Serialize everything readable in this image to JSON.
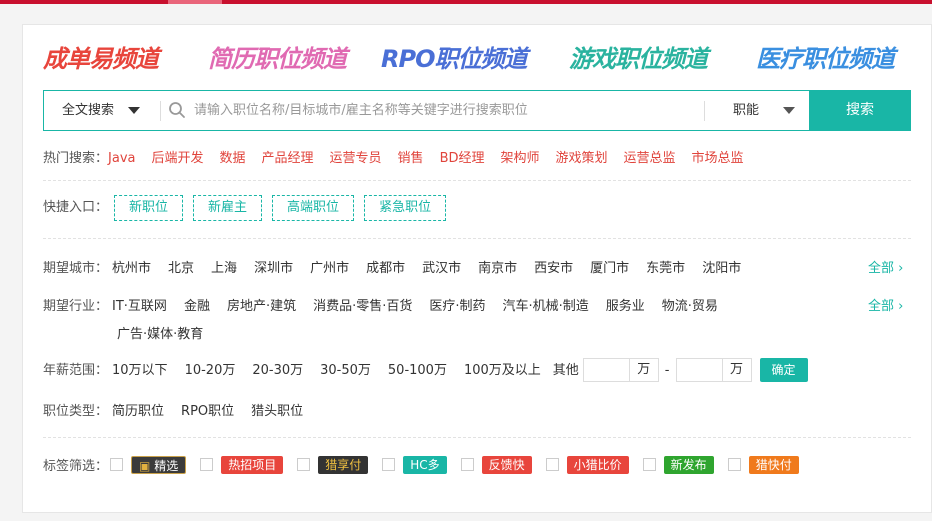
{
  "channels": [
    {
      "label": "成单易频道",
      "color": "#e8453c"
    },
    {
      "label": "简历职位频道",
      "color": "#e06ab2"
    },
    {
      "label": "RPO职位频道",
      "color": "#4a6fd6"
    },
    {
      "label": "游戏职位频道",
      "color": "#2ab39f"
    },
    {
      "label": "医疗职位频道",
      "color": "#3a8fe0"
    }
  ],
  "search": {
    "scope": "全文搜索",
    "placeholder": "请输入职位名称/目标城市/雇主名称等关键字进行搜索职位",
    "function": "职能",
    "button": "搜索",
    "accent": "#19b6a6"
  },
  "hot": {
    "label": "热门搜索：",
    "items": [
      "Java",
      "后端开发",
      "数据",
      "产品经理",
      "运营专员",
      "销售",
      "BD经理",
      "架构师",
      "游戏策划",
      "运营总监",
      "市场总监"
    ]
  },
  "quick": {
    "label": "快捷入口：",
    "items": [
      "新职位",
      "新雇主",
      "高端职位",
      "紧急职位"
    ]
  },
  "city": {
    "label": "期望城市：",
    "items": [
      "杭州市",
      "北京",
      "上海",
      "深圳市",
      "广州市",
      "成都市",
      "武汉市",
      "南京市",
      "西安市",
      "厦门市",
      "东莞市",
      "沈阳市"
    ],
    "all": "全部"
  },
  "industry": {
    "label": "期望行业：",
    "items": [
      "IT·互联网",
      "金融",
      "房地产·建筑",
      "消费品·零售·百货",
      "医疗·制药",
      "汽车·机械·制造",
      "服务业",
      "物流·贸易"
    ],
    "items2": [
      "广告·媒体·教育"
    ],
    "all": "全部"
  },
  "salary": {
    "label": "年薪范围：",
    "items": [
      "10万以下",
      "10-20万",
      "20-30万",
      "30-50万",
      "50-100万",
      "100万及以上"
    ],
    "other": "其他",
    "unit": "万",
    "dash": "-",
    "confirm": "确定"
  },
  "jobtype": {
    "label": "职位类型：",
    "items": [
      "简历职位",
      "RPO职位",
      "猎头职位"
    ]
  },
  "tags": {
    "label": "标签筛选：",
    "items": [
      {
        "label": "精选",
        "color": "#3b3b3b"
      },
      {
        "label": "热招项目",
        "color": "#e8453c"
      },
      {
        "label": "猎享付",
        "color": "#333333"
      },
      {
        "label": "HC多",
        "color": "#19b6a6"
      },
      {
        "label": "反馈快",
        "color": "#e8453c"
      },
      {
        "label": "小猎比价",
        "color": "#e8453c"
      },
      {
        "label": "新发布",
        "color": "#2fa52f"
      },
      {
        "label": "猎快付",
        "color": "#f07a1c"
      }
    ]
  }
}
